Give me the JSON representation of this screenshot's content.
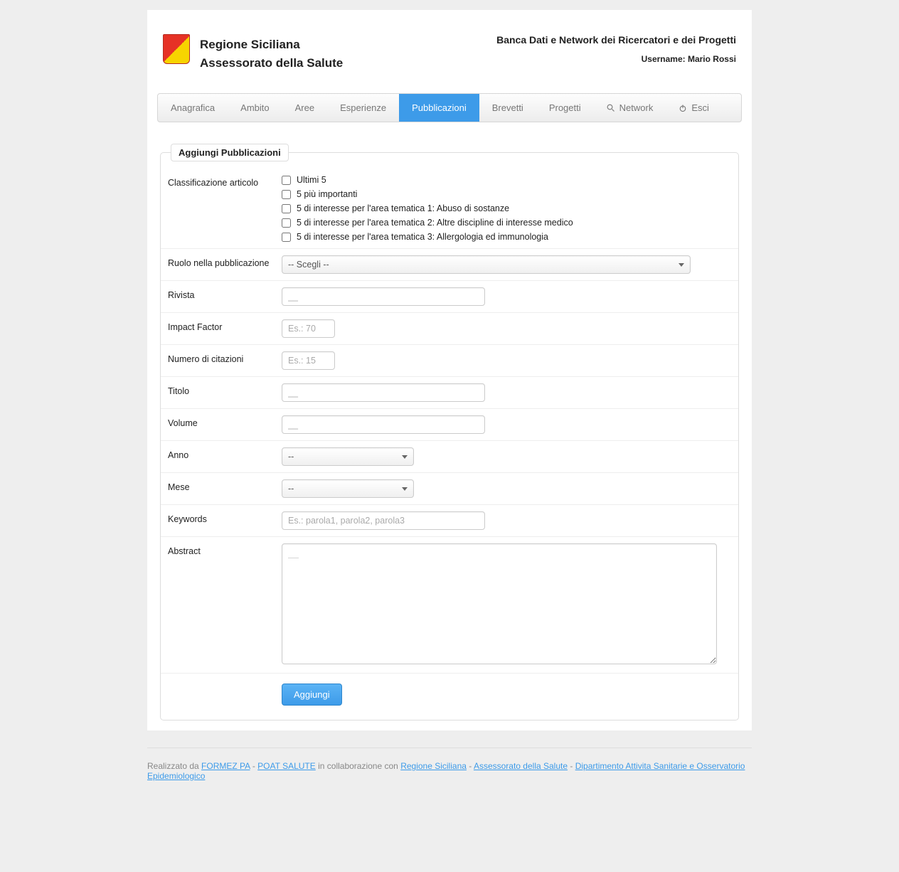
{
  "header": {
    "org1": "Regione Siciliana",
    "org2": "Assessorato della Salute",
    "title": "Banca Dati e Network dei Ricercatori e dei Progetti",
    "user_label": "Username: Mario Rossi"
  },
  "nav": {
    "items": [
      "Anagrafica",
      "Ambito",
      "Aree",
      "Esperienze",
      "Pubblicazioni",
      "Brevetti",
      "Progetti",
      "Network",
      "Esci"
    ],
    "active_index": 4
  },
  "form": {
    "legend": "Aggiungi Pubblicazioni",
    "labels": {
      "classificazione": "Classificazione articolo",
      "ruolo": "Ruolo nella pubblicazione",
      "rivista": "Rivista",
      "impact": "Impact Factor",
      "citazioni": "Numero di citazioni",
      "titolo": "Titolo",
      "volume": "Volume",
      "anno": "Anno",
      "mese": "Mese",
      "keywords": "Keywords",
      "abstract": "Abstract"
    },
    "checkboxes": [
      "Ultimi 5",
      "5 più importanti",
      "5 di interesse per l'area tematica 1: Abuso di sostanze",
      "5 di interesse per l'area tematica 2: Altre discipline di interesse medico",
      "5 di interesse per l'area tematica 3: Allergologia ed immunologia"
    ],
    "placeholders": {
      "ruolo": "-- Scegli --",
      "rivista": "__",
      "impact": "Es.: 70",
      "citazioni": "Es.: 15",
      "titolo": "__",
      "volume": "__",
      "anno": "--",
      "mese": "--",
      "keywords": "Es.: parola1, parola2, parola3",
      "abstract": "__"
    },
    "submit": "Aggiungi"
  },
  "footer": {
    "pre": "Realizzato da ",
    "l1": "FORMEZ PA",
    "sep1": " - ",
    "l2": "POAT SALUTE",
    "mid": " in collaborazione con ",
    "l3": "Regione Siciliana",
    "sep2": " - ",
    "l4": "Assessorato della Salute",
    "sep3": " - ",
    "l5": "Dipartimento Attivita Sanitarie e Osservatorio Epidemiologico"
  }
}
